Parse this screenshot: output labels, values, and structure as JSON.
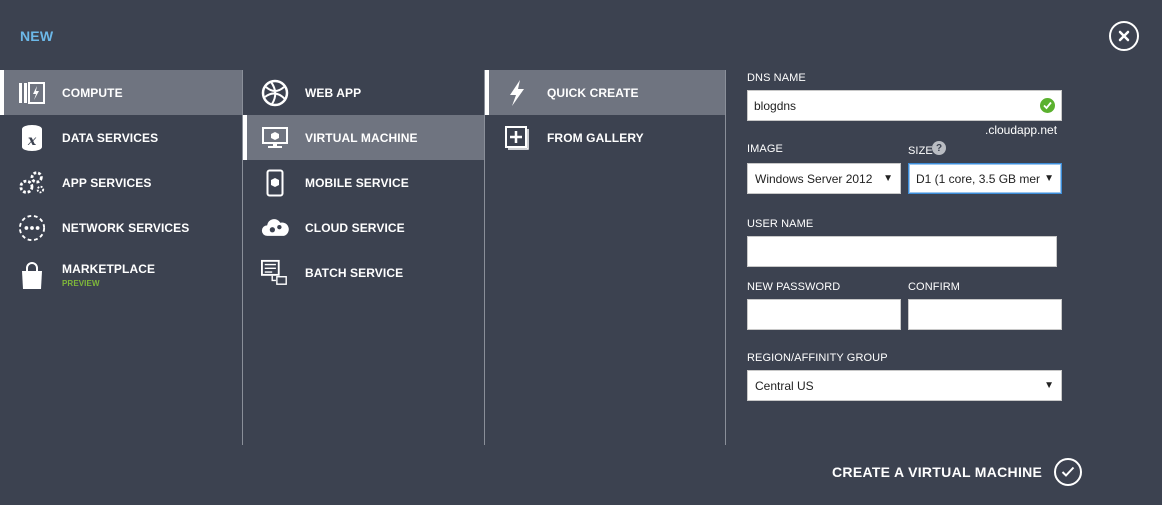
{
  "header": {
    "title": "NEW"
  },
  "col1": {
    "items": [
      {
        "label": "COMPUTE",
        "icon": "compute-icon"
      },
      {
        "label": "DATA SERVICES",
        "icon": "data-services-icon"
      },
      {
        "label": "APP SERVICES",
        "icon": "app-services-icon"
      },
      {
        "label": "NETWORK SERVICES",
        "icon": "network-services-icon"
      },
      {
        "label": "MARKETPLACE",
        "sub": "PREVIEW",
        "icon": "shopping-bag-icon"
      }
    ]
  },
  "col2": {
    "items": [
      {
        "label": "WEB APP",
        "icon": "web-app-icon"
      },
      {
        "label": "VIRTUAL MACHINE",
        "icon": "monitor-icon"
      },
      {
        "label": "MOBILE SERVICE",
        "icon": "mobile-icon"
      },
      {
        "label": "CLOUD SERVICE",
        "icon": "cloud-gear-icon"
      },
      {
        "label": "BATCH SERVICE",
        "icon": "batch-icon"
      }
    ]
  },
  "col3": {
    "items": [
      {
        "label": "QUICK CREATE",
        "icon": "lightning-icon"
      },
      {
        "label": "FROM GALLERY",
        "icon": "plus-box-icon"
      }
    ]
  },
  "form": {
    "dns_label": "DNS NAME",
    "dns_value": "blogdns",
    "dns_suffix": ".cloudapp.net",
    "image_label": "IMAGE",
    "image_value": "Windows Server 2012",
    "size_label": "SIZE",
    "size_help": "?",
    "size_value": "D1 (1 core, 3.5 GB mer",
    "username_label": "USER NAME",
    "username_value": "",
    "password_label": "NEW PASSWORD",
    "password_value": "",
    "confirm_label": "CONFIRM",
    "confirm_value": "",
    "region_label": "REGION/AFFINITY GROUP",
    "region_value": "Central US",
    "caret": "▼"
  },
  "footer": {
    "create_label": "CREATE A VIRTUAL MACHINE"
  },
  "colors": {
    "background": "#3c4250",
    "selected": "#6f7480",
    "title_accent": "#6cb8e8",
    "preview_green": "#7fb83a",
    "check_green": "#5bb12f"
  }
}
